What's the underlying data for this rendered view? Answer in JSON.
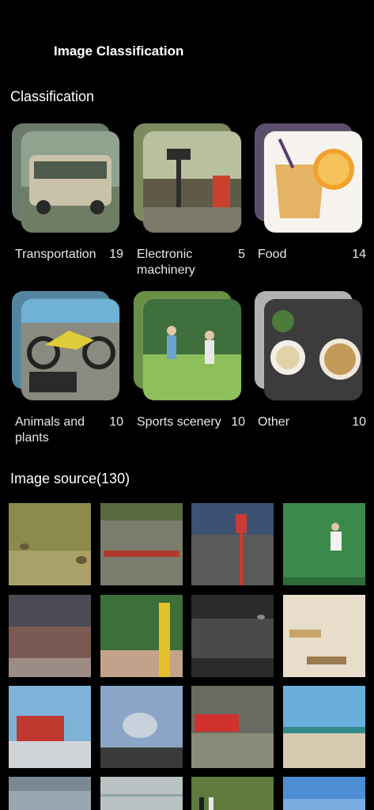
{
  "header": {
    "title": "Image Classification"
  },
  "classification": {
    "heading": "Classification",
    "categories": [
      {
        "name": "Transportation",
        "count": "19",
        "icon": "bus-photo",
        "colors": [
          "#8fa38f",
          "#c9c2a8",
          "#4e5a4b"
        ]
      },
      {
        "name": "Electronic machinery",
        "count": "5",
        "icon": "street-lamp-photo",
        "colors": [
          "#a7b77e",
          "#5f5a45",
          "#c9402f"
        ]
      },
      {
        "name": "Food",
        "count": "14",
        "icon": "drink-photo",
        "colors": [
          "#7a6a8f",
          "#e4b366",
          "#f7f4ef"
        ]
      },
      {
        "name": "Animals and plants",
        "count": "10",
        "icon": "motorcycle-photo",
        "colors": [
          "#6fb2d6",
          "#5c5e4e",
          "#dfcc3a"
        ]
      },
      {
        "name": "Sports scenery",
        "count": "10",
        "icon": "frisbee-players-photo",
        "colors": [
          "#8fbf5b",
          "#3f6f3c",
          "#c7d6a5"
        ]
      },
      {
        "name": "Other",
        "count": "10",
        "icon": "meal-tray-photo",
        "colors": [
          "#ececec",
          "#3c3c3c",
          "#c49a58"
        ]
      }
    ]
  },
  "source": {
    "heading": "Image source(130)",
    "thumbnails": [
      {
        "icon": "sheep-field-photo",
        "colors": [
          "#8c8a4d",
          "#6a7a3a",
          "#a9a168"
        ]
      },
      {
        "icon": "boat-race-photo",
        "colors": [
          "#5b6a3e",
          "#7a7d6b",
          "#b13b2e"
        ]
      },
      {
        "icon": "parking-sign-photo",
        "colors": [
          "#3d5272",
          "#5a5a58",
          "#cc3b33"
        ]
      },
      {
        "icon": "tennis-player-photo",
        "colors": [
          "#3c8a4a",
          "#2d6b39",
          "#f2f2f2"
        ]
      },
      {
        "icon": "train-station-photo",
        "colors": [
          "#4c4a55",
          "#7b5a53",
          "#9d8c86"
        ]
      },
      {
        "icon": "street-fire-hydrant-photo",
        "colors": [
          "#3c6f3a",
          "#c3a28b",
          "#e3c12b"
        ]
      },
      {
        "icon": "water-waves-photo",
        "colors": [
          "#2b2b2b",
          "#4a4a48",
          "#8b8a86"
        ]
      },
      {
        "icon": "wooden-forks-photo",
        "colors": [
          "#e8ddca",
          "#c8a46a",
          "#9a7b4f"
        ]
      },
      {
        "icon": "fire-truck-photo",
        "colors": [
          "#7fb2d8",
          "#cfd4d9",
          "#c1382e"
        ]
      },
      {
        "icon": "seagull-photo",
        "colors": [
          "#8aa5c5",
          "#c9d2dc",
          "#3a3a3a"
        ]
      },
      {
        "icon": "red-train-photo",
        "colors": [
          "#6a6a60",
          "#8a8a78",
          "#d0312d"
        ]
      },
      {
        "icon": "beach-plane-photo",
        "colors": [
          "#6aaedc",
          "#d6cbb0",
          "#2f8a8e"
        ]
      },
      {
        "icon": "sea-photo",
        "colors": [
          "#7a8a95",
          "#9aa7b0",
          "#c3cbd0"
        ]
      },
      {
        "icon": "sky-fence-photo",
        "colors": [
          "#8fa3a7",
          "#b9c1c2",
          "#dfe3e4"
        ]
      },
      {
        "icon": "zebra-photo",
        "colors": [
          "#5f7a3d",
          "#1d1d1d",
          "#e8e8e8"
        ]
      },
      {
        "icon": "sky-photo",
        "colors": [
          "#4d8dd2",
          "#7aaee2",
          "#b8d3ef"
        ]
      }
    ]
  }
}
